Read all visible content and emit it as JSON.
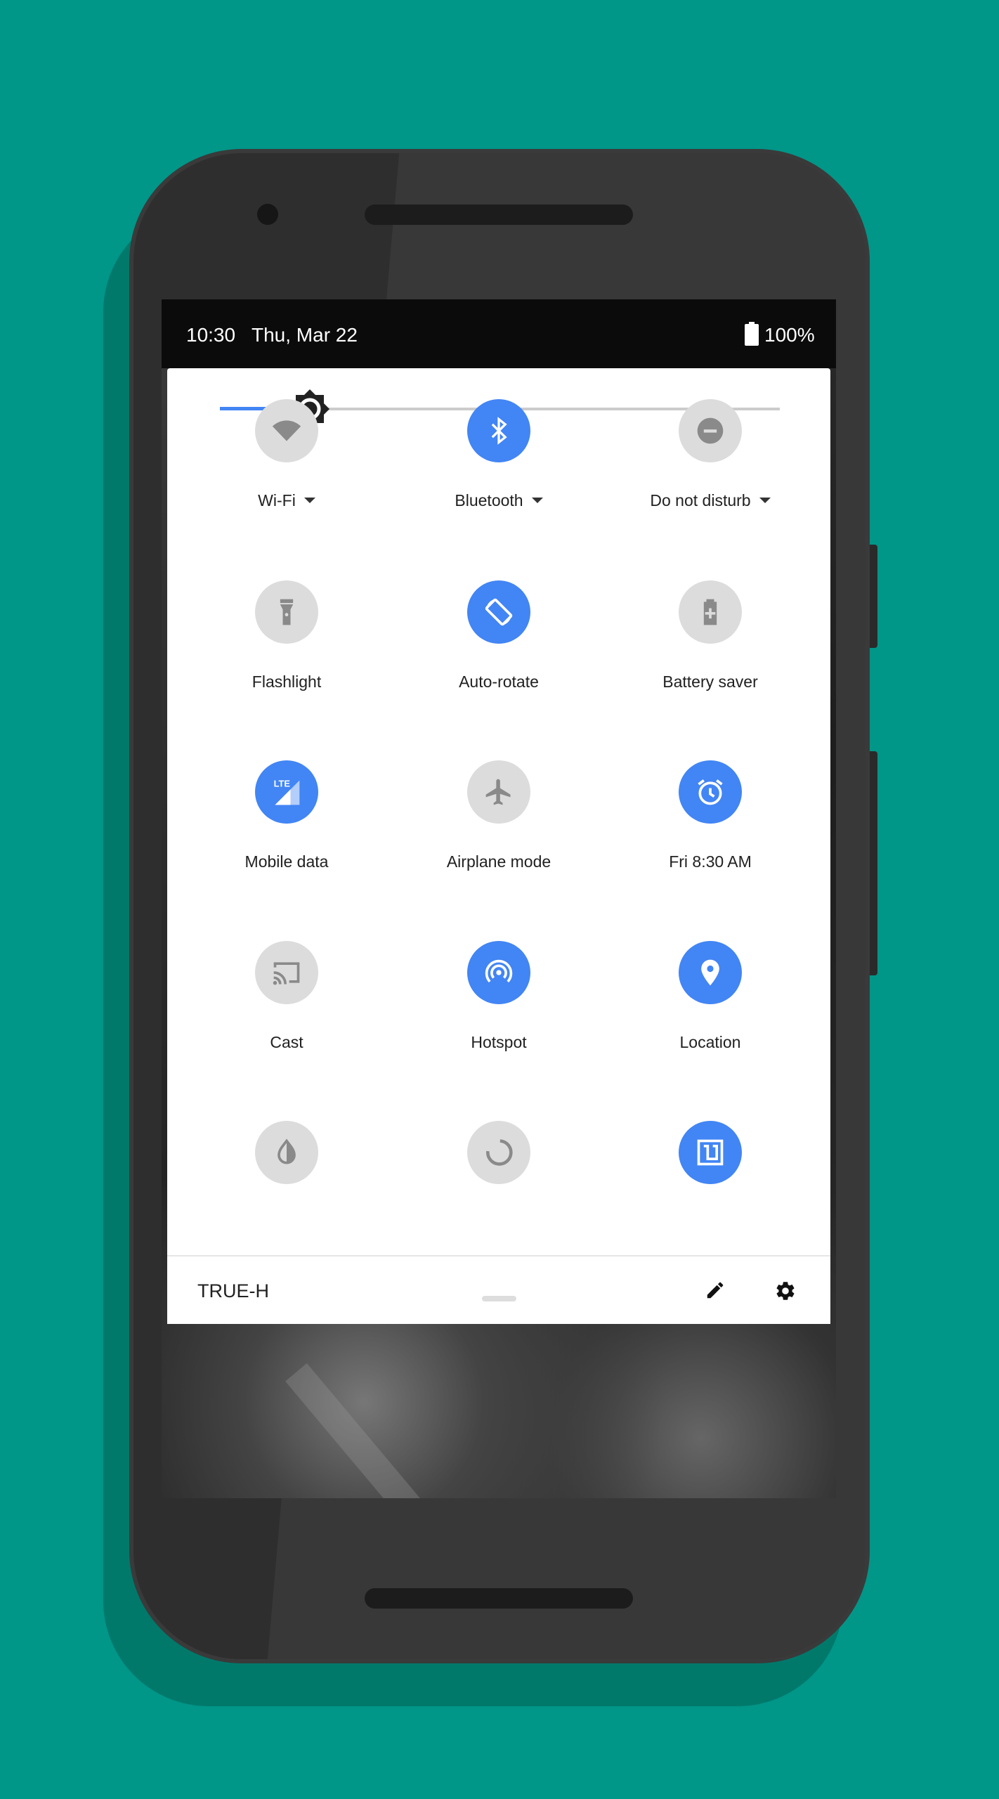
{
  "status_bar": {
    "time": "10:30",
    "date": "Thu, Mar 22",
    "battery": "100%",
    "battery_icon": "battery-full-icon"
  },
  "brightness": {
    "level_percent": 16,
    "icon": "brightness-icon",
    "colors": {
      "active": "#4285f4",
      "track": "#cccccc"
    }
  },
  "tiles": [
    {
      "label": "Wi-Fi",
      "icon": "wifi-icon",
      "active": false,
      "dropdown": true
    },
    {
      "label": "Bluetooth",
      "icon": "bluetooth-icon",
      "active": true,
      "dropdown": true
    },
    {
      "label": "Do not disturb",
      "icon": "do-not-disturb-icon",
      "active": false,
      "dropdown": true
    },
    {
      "label": "Flashlight",
      "icon": "flashlight-icon",
      "active": false
    },
    {
      "label": "Auto-rotate",
      "icon": "auto-rotate-icon",
      "active": true
    },
    {
      "label": "Battery saver",
      "icon": "battery-saver-icon",
      "active": false
    },
    {
      "label": "Mobile data",
      "icon": "mobile-data-icon",
      "active": true,
      "badge": "LTE"
    },
    {
      "label": "Airplane mode",
      "icon": "airplane-icon",
      "active": false
    },
    {
      "label": "Fri 8:30 AM",
      "icon": "alarm-icon",
      "active": true
    },
    {
      "label": "Cast",
      "icon": "cast-icon",
      "active": false
    },
    {
      "label": "Hotspot",
      "icon": "hotspot-icon",
      "active": true
    },
    {
      "label": "Location",
      "icon": "location-icon",
      "active": true
    },
    {
      "label": "",
      "icon": "invert-colors-icon",
      "active": false
    },
    {
      "label": "",
      "icon": "data-saver-icon",
      "active": false
    },
    {
      "label": "",
      "icon": "nfc-icon",
      "active": true
    }
  ],
  "footer": {
    "carrier": "TRUE-H",
    "edit_icon": "edit-icon",
    "settings_icon": "settings-icon"
  },
  "colors": {
    "background": "#009688",
    "accent": "#4285f4",
    "tile_off": "#dcdcdc"
  }
}
